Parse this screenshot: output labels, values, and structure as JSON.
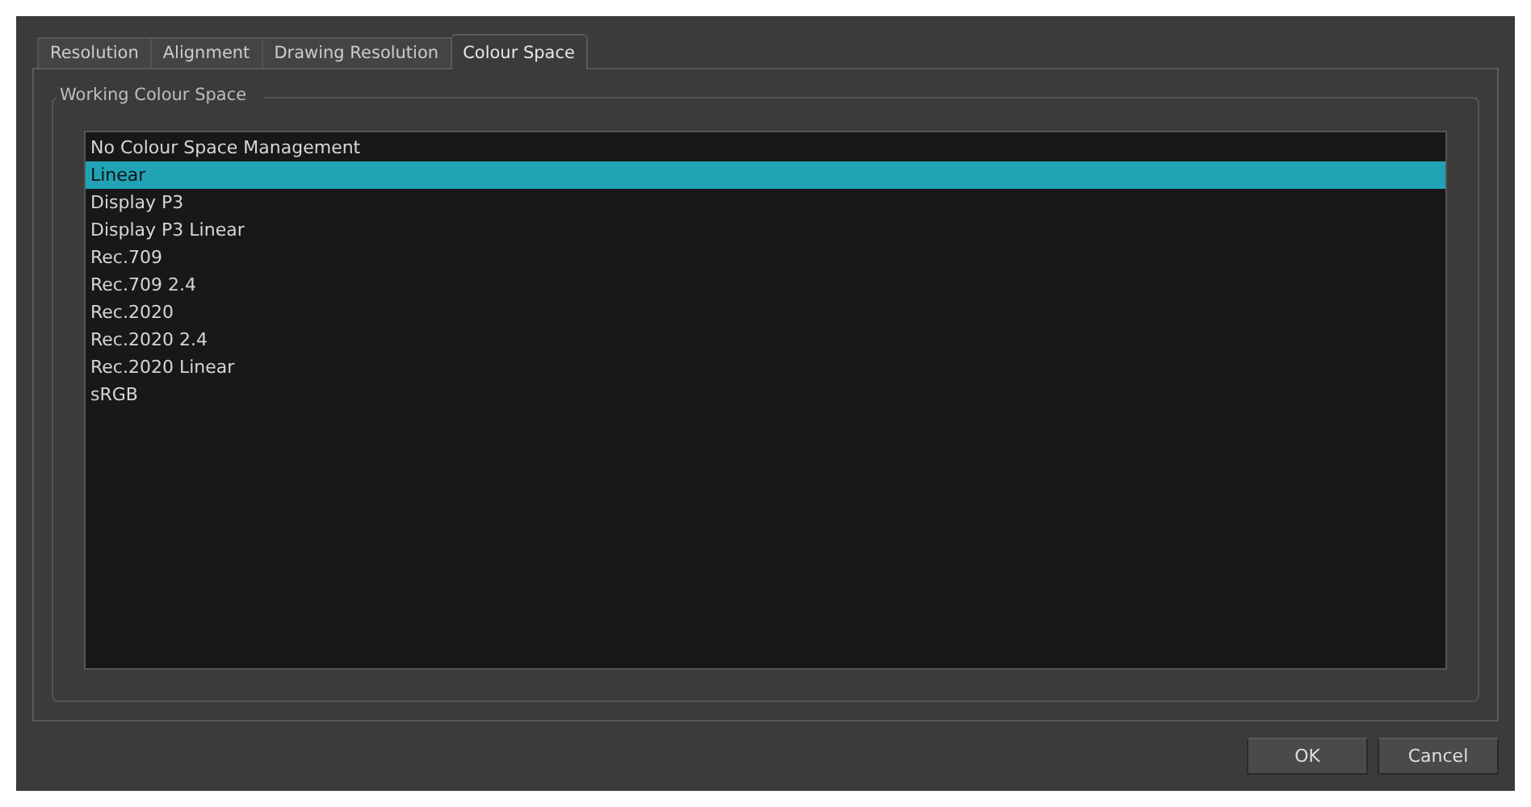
{
  "tabs": [
    {
      "label": "Resolution",
      "selected": false
    },
    {
      "label": "Alignment",
      "selected": false
    },
    {
      "label": "Drawing Resolution",
      "selected": false
    },
    {
      "label": "Colour Space",
      "selected": true
    }
  ],
  "group": {
    "title": "Working Colour Space"
  },
  "list": [
    {
      "label": "No Colour Space Management",
      "selected": false
    },
    {
      "label": "Linear",
      "selected": true
    },
    {
      "label": "Display P3",
      "selected": false
    },
    {
      "label": "Display P3 Linear",
      "selected": false
    },
    {
      "label": "Rec.709",
      "selected": false
    },
    {
      "label": "Rec.709 2.4",
      "selected": false
    },
    {
      "label": "Rec.2020",
      "selected": false
    },
    {
      "label": "Rec.2020 2.4",
      "selected": false
    },
    {
      "label": "Rec.2020 Linear",
      "selected": false
    },
    {
      "label": "sRGB",
      "selected": false
    }
  ],
  "buttons": [
    "OK",
    "Cancel"
  ]
}
